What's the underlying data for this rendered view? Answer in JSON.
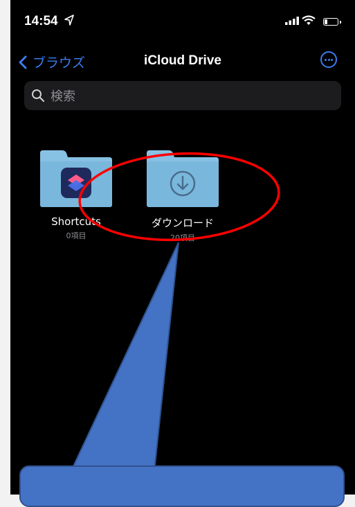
{
  "status": {
    "time": "14:54"
  },
  "nav": {
    "back_label": "ブラウズ",
    "title": "iCloud Drive"
  },
  "search": {
    "placeholder": "検索"
  },
  "folders": [
    {
      "name": "Shortcuts",
      "count": "0項目"
    },
    {
      "name": "ダウンロード",
      "count": "20項目"
    }
  ],
  "colors": {
    "accent": "#3c7cf0",
    "folder": "#87c1e4",
    "highlight": "#ff0000",
    "callout": "#4472c4"
  },
  "icons": [
    "location-arrow-icon",
    "signal-icon",
    "wifi-icon",
    "battery-icon",
    "chevron-left-icon",
    "more-icon",
    "search-icon",
    "shortcuts-app-icon",
    "download-icon"
  ]
}
